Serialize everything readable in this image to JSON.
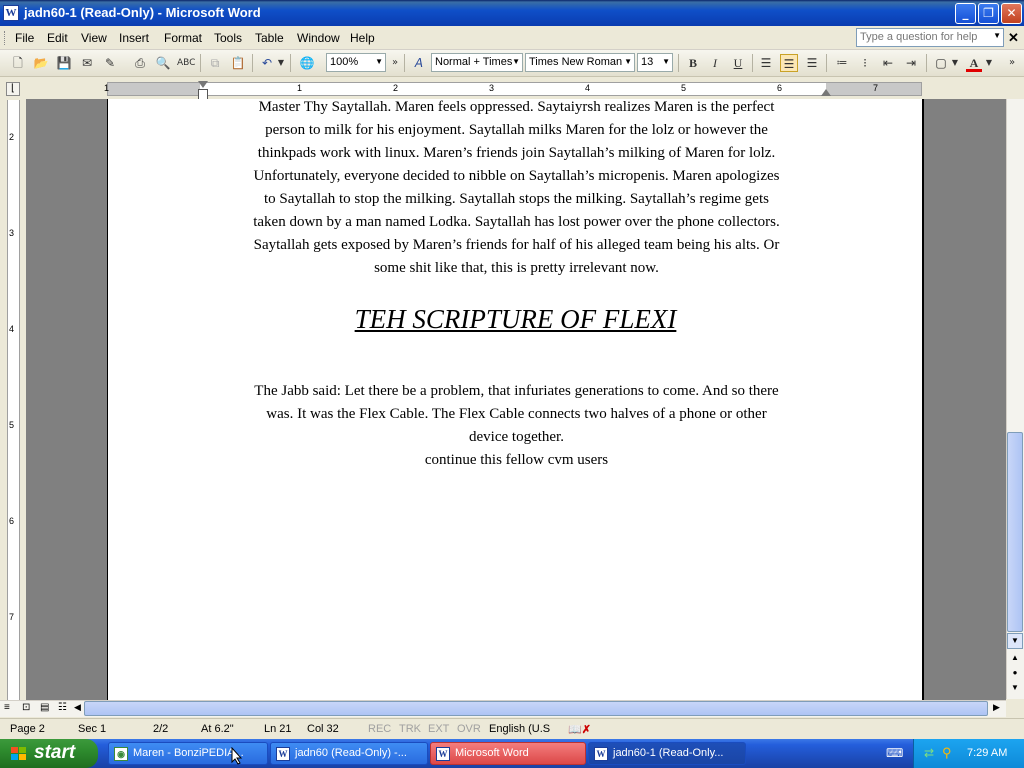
{
  "window": {
    "title": "jadn60-1 (Read-Only) - Microsoft Word",
    "minimize": "_",
    "restore": "❐",
    "close": "✕"
  },
  "menu": {
    "items": [
      "File",
      "Edit",
      "View",
      "Insert",
      "Format",
      "Tools",
      "Table",
      "Window",
      "Help"
    ],
    "help_placeholder": "Type a question for help",
    "close_doc": "✕"
  },
  "toolbar": {
    "zoom": "100%",
    "style": "Normal + Times",
    "font": "Times New Roman",
    "size": "13",
    "bold": "B",
    "italic": "I",
    "underline": "U",
    "font_color": "#e00000"
  },
  "ruler": {
    "numbers": [
      "1",
      "1",
      "2",
      "3",
      "4",
      "5",
      "6",
      "7"
    ],
    "vnumbers": [
      "2",
      "3",
      "4",
      "5",
      "6",
      "7"
    ]
  },
  "document": {
    "paragraph1_lines": [
      "Master Thy Saytallah. Maren feels oppressed. Saytaiyrsh realizes Maren is the perfect",
      "person to milk for his enjoyment. Saytallah milks Maren for the lolz or however the",
      "thinkpads work with linux. Maren’s friends join Saytallah’s milking of Maren for lolz.",
      "Unfortunately, everyone decided to nibble on Saytallah’s micropenis. Maren apologizes",
      "to Saytallah to stop the milking. Saytallah stops the milking. Saytallah’s regime gets",
      "taken down by a man named Lodka. Saytallah has lost power over the phone collectors.",
      "Saytallah gets exposed by Maren’s friends for half of his alleged team being his alts. Or",
      "some shit like that, this is pretty irrelevant now."
    ],
    "heading": "TEH SCRIPTURE OF FLEXI",
    "paragraph2_lines": [
      "The Jabb said: Let there be a problem, that infuriates generations to come. And so there",
      "was. It was the Flex Cable. The Flex Cable connects two halves of a phone or other",
      "device together.",
      "continue this fellow cvm users"
    ]
  },
  "status": {
    "page": "Page 2",
    "sec": "Sec 1",
    "pages": "2/2",
    "at": "At 6.2\"",
    "ln": "Ln 21",
    "col": "Col 32",
    "rec": "REC",
    "trk": "TRK",
    "ext": "EXT",
    "ovr": "OVR",
    "language": "English (U.S"
  },
  "taskbar": {
    "start": "start",
    "tasks": [
      "Maren - BonziPEDIA...",
      "jadn60 (Read-Only) -...",
      "Microsoft Word",
      "jadn60-1 (Read-Only..."
    ],
    "clock": "7:29 AM"
  }
}
